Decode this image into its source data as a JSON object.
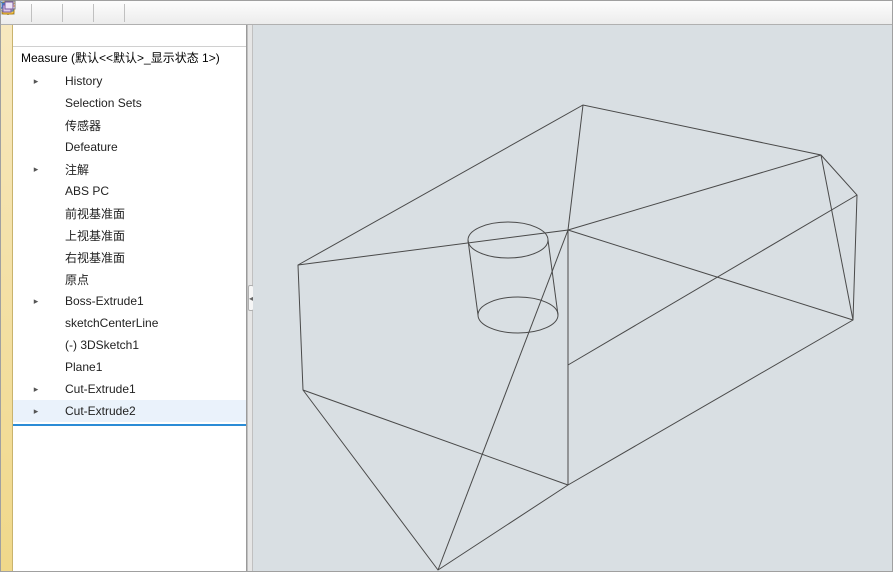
{
  "partHeader": "Measure  (默认<<默认>_显示状态 1>)",
  "tree": [
    {
      "label": "History",
      "expandable": true,
      "indent": 1,
      "icon": "history"
    },
    {
      "label": "Selection Sets",
      "expandable": false,
      "indent": 1,
      "icon": "sets"
    },
    {
      "label": "传感器",
      "expandable": false,
      "indent": 1,
      "icon": "sensor"
    },
    {
      "label": "Defeature",
      "expandable": false,
      "indent": 1,
      "icon": "defeature"
    },
    {
      "label": "注解",
      "expandable": true,
      "indent": 1,
      "icon": "annotation"
    },
    {
      "label": "ABS PC",
      "expandable": false,
      "indent": 1,
      "icon": "material"
    },
    {
      "label": "前视基准面",
      "expandable": false,
      "indent": 1,
      "icon": "plane"
    },
    {
      "label": "上视基准面",
      "expandable": false,
      "indent": 1,
      "icon": "plane"
    },
    {
      "label": "右视基准面",
      "expandable": false,
      "indent": 1,
      "icon": "plane"
    },
    {
      "label": "原点",
      "expandable": false,
      "indent": 1,
      "icon": "origin"
    },
    {
      "label": "Boss-Extrude1",
      "expandable": true,
      "indent": 1,
      "icon": "extrude"
    },
    {
      "label": "sketchCenterLine",
      "expandable": false,
      "indent": 1,
      "icon": "sketch"
    },
    {
      "label": "(-) 3DSketch1",
      "expandable": false,
      "indent": 1,
      "icon": "3dsketch"
    },
    {
      "label": "Plane1",
      "expandable": false,
      "indent": 1,
      "icon": "plane"
    },
    {
      "label": "Cut-Extrude1",
      "expandable": true,
      "indent": 1,
      "icon": "cut"
    },
    {
      "label": "Cut-Extrude2",
      "expandable": true,
      "indent": 1,
      "icon": "cut"
    }
  ]
}
